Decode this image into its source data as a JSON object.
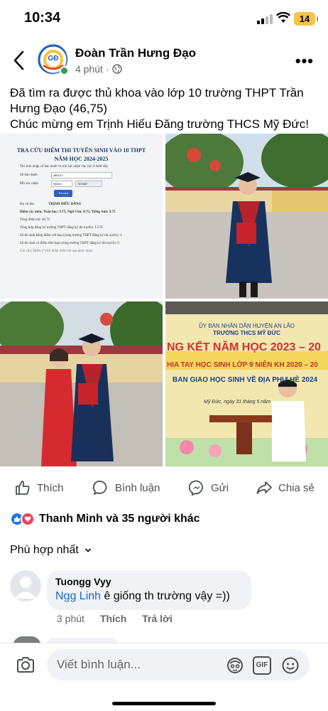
{
  "status_bar": {
    "time": "10:34",
    "battery": "14"
  },
  "post": {
    "author": "Đoàn Trần Hưng Đạo",
    "time": "4 phút",
    "avatar_text": "GĐ",
    "caption_line1": "Đã tìm ra được thủ khoa vào lớp 10 trường THPT Trần Hưng Đạo (46,75)",
    "caption_line2": "Chúc mừng em Trịnh Hiếu Đăng trường THCS Mỹ Đức!"
  },
  "photos": {
    "lookup": {
      "title1": "TRA CỨU ĐIỂM THI TUYỂN SINH VÀO 10 THPT",
      "title2": "NĂM HỌC 2024-2025",
      "prompt": "Thí sinh nhập số báo danh và mã xác nhận vào các ô dưới đây",
      "sbd_label": "Số báo danh",
      "sbd_value": "160727",
      "captcha_label": "Mã xác nhận",
      "captcha_value": "9nGnx",
      "captcha_image": "767x0t7",
      "button": "Tra cứu",
      "name_label": "Họ và tên:",
      "name_value": "TRỊNH HIẾU ĐĂNG",
      "scores": "Điểm các môn:  Toán học: 9.75; Ngữ Văn: 8.75; Tiếng Anh: 9.75",
      "total": "Tổng điểm thi:   46.75",
      "total_reg": "Tổng hợp đăng ký trường THPT đăng ký thi tuyển):   1.578",
      "ranking": "Số thí sinh bằng điểm với bạn (cùng trường THPT đăng ký thi tuyển):   1",
      "ranking2": "Số thí sinh có điểm trên bạn (cùng trường THPT đăng ký thi tuyển):   0",
      "note": "Ghi chú: Điểm (*) thì kiểm điểm thi sau phúc khảo"
    },
    "banner": {
      "line1": "ỦY BAN NHÂN DÂN HUYỆN AN LÃO",
      "line2": "TRƯỜNG THCS MỸ ĐỨC",
      "line3": "NG KẾT NĂM HỌC 2023 – 20",
      "line4": "HIA TAY HỌC SINH LỚP 9 NIÊN KH 2020 – 20",
      "line5": "BAN GIAO HỌC SINH VỀ ĐỊA PHƯ HÈ 2024",
      "line6": "Mỹ Đức, ngày 31 tháng 5 năm"
    }
  },
  "actions": {
    "like": "Thích",
    "comment": "Bình luận",
    "send": "Gửi",
    "share": "Chia sẻ"
  },
  "reactions": {
    "text": "Thanh Minh và 35 người khác"
  },
  "sort": {
    "label": "Phù hợp nhất"
  },
  "comment": {
    "author": "Tuongg Vyy",
    "mention": "Ngg Linh",
    "text": " ê giống th trường vậy =))",
    "time": "3 phút",
    "like": "Thích",
    "reply": "Trả lời"
  },
  "composer": {
    "placeholder": "Viết bình luận...",
    "gif": "GIF"
  },
  "colors": {
    "accent": "#1866d6",
    "like_blue": "#1877f2",
    "love_red": "#f33e58"
  }
}
